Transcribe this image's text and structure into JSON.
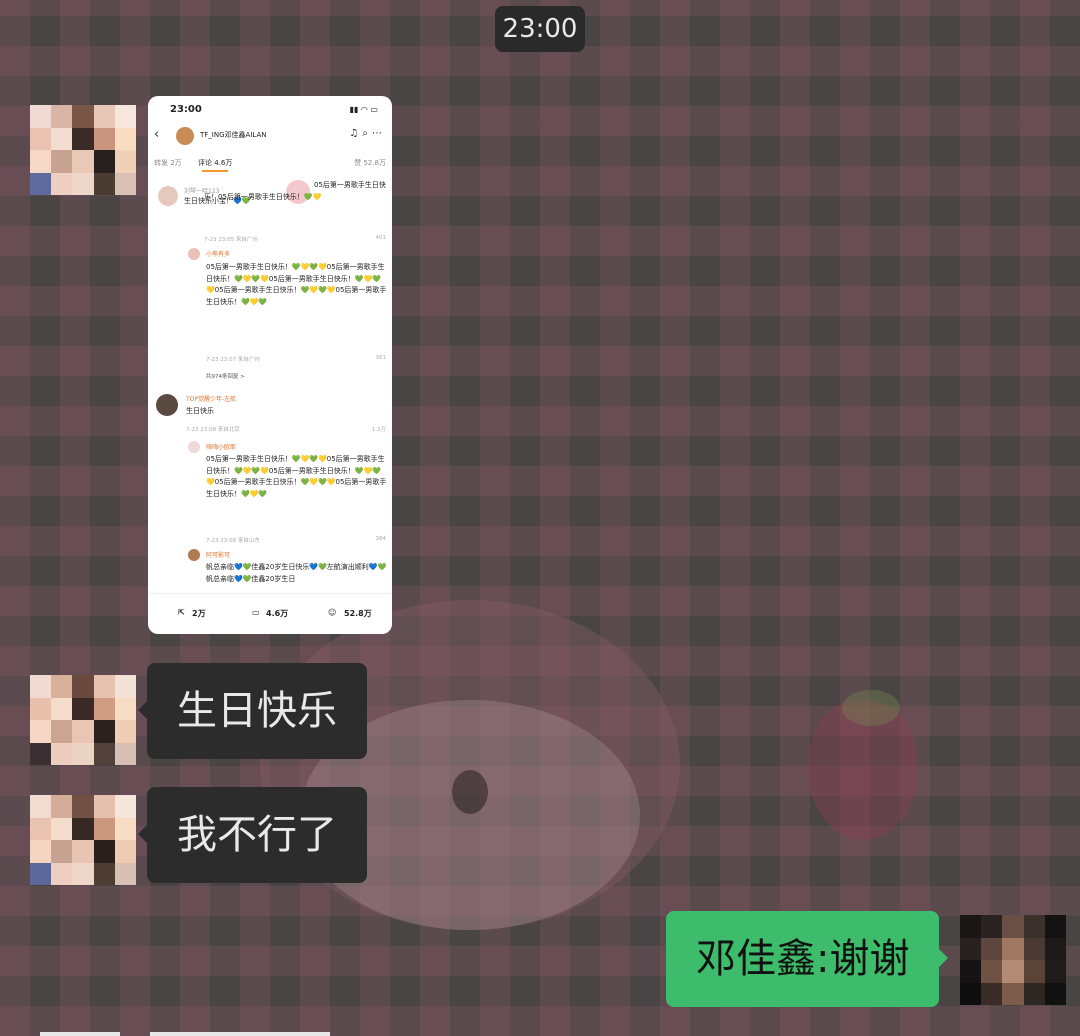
{
  "timestamp": "23:00",
  "shared_screenshot": {
    "status_time": "23:00",
    "account_name": "TF_ING邓佳鑫AILAN",
    "tabs": [
      "转发 2万",
      "评论 4.6万",
      "赞 52.8万"
    ],
    "comments": [
      {
        "user": "刘琴一哈123",
        "text": "生日快乐小宝！💙💚",
        "reply_preview": "05后第一男歌手生日快乐！05后第一男歌手生日快乐！💚💛",
        "meta": "7-23 23:05  来自广州",
        "likes": "401"
      },
      {
        "user": "小熊有多",
        "text": "05后第一男歌手生日快乐！💚💛💚💛05后第一男歌手生日快乐！💚💛💚💛05后第一男歌手生日快乐！💚💛💚💛05后第一男歌手生日快乐！💚💛💚💛05后第一男歌手生日快乐！💚💛💚",
        "meta": "7-23 23:07  来自广州",
        "likes": "361",
        "more": "共974条回复 >"
      },
      {
        "user": "TOP觉醒少年-左航",
        "text": "生日快乐",
        "meta": "7-23 23:08  来自北京",
        "likes": "1.3万"
      },
      {
        "user": "嗨嗨小欧耶",
        "text": "05后第一男歌手生日快乐！💚💛💚💛05后第一男歌手生日快乐！💚💛💚💛05后第一男歌手生日快乐！💚💛💚💛05后第一男歌手生日快乐！💚💛💚💛05后第一男歌手生日快乐！💚💛💚",
        "meta": "7-23 23:08  来自山东",
        "likes": "384"
      },
      {
        "user": "阿可影可",
        "text": "帆总亲临💙💚佳鑫20岁生日快乐💙💚左航演出顺利💙💚帆总亲临💙💚佳鑫20岁生日"
      }
    ],
    "bottom_bar": {
      "repost": "2万",
      "comments": "4.6万",
      "likes": "52.8万"
    }
  },
  "messages": [
    {
      "side": "in",
      "text": "生日快乐"
    },
    {
      "side": "in",
      "text": "我不行了"
    },
    {
      "side": "out",
      "text": "邓佳鑫:谢谢"
    }
  ],
  "colors": {
    "incoming_bubble": "#2c2c2c",
    "outgoing_bubble": "#3dbd6c",
    "time_pill": "#2b2a2a"
  }
}
